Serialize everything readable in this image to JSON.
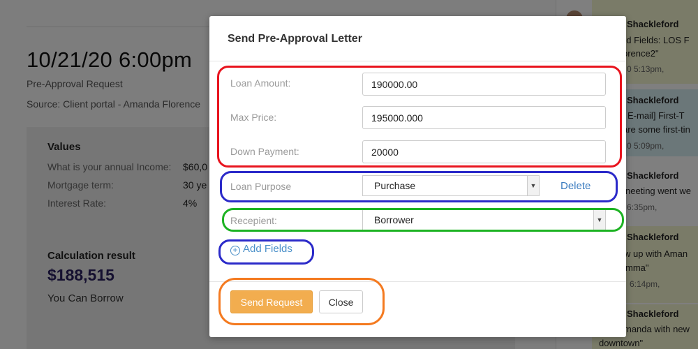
{
  "background": {
    "date": "10/21/20 6:00pm",
    "request_type": "Pre-Approval Request",
    "source": "Source: Client portal - Amanda Florence",
    "values_title": "Values",
    "values_rows": [
      {
        "label": "What is your annual Income:",
        "value": "$60,0"
      },
      {
        "label": "Mortgage term:",
        "value": "30 ye"
      },
      {
        "label": "Interest Rate:",
        "value": "4%"
      }
    ],
    "calc_title": "Calculation result",
    "calc_amount": "$188,515",
    "calc_sub": "You Can Borrow"
  },
  "messages": [
    {
      "name": "Shackleford",
      "lines": [
        "ed Fields: LOS F",
        "orence2\""
      ],
      "time": "0 5:13pm,"
    },
    {
      "name": "Shackleford",
      "lines": [
        "| E-mail] First-T",
        "are some first-tin"
      ],
      "time": "0 5:09pm,"
    },
    {
      "name": "Shackleford",
      "lines": [
        "neeting went we"
      ],
      "time": "6:35pm,"
    },
    {
      "name": "Shackleford",
      "lines": [
        "w up with Aman",
        "mma\""
      ],
      "time": "6:14pm,"
    },
    {
      "name": "Shackleford",
      "lines": [
        "manda with new",
        "downtown\""
      ],
      "time": ""
    }
  ],
  "modal": {
    "title": "Send Pre-Approval Letter",
    "fields": {
      "loan_amount_label": "Loan Amount:",
      "loan_amount_value": "190000.00",
      "max_price_label": "Max Price:",
      "max_price_value": "195000.000",
      "down_payment_label": "Down Payment:",
      "down_payment_value": "20000",
      "loan_purpose_label": "Loan Purpose",
      "loan_purpose_value": "Purchase",
      "delete_label": "Delete",
      "recipient_label": "Recepient:",
      "recipient_value": "Borrower",
      "add_fields_label": "Add Fields"
    },
    "buttons": {
      "send": "Send Request",
      "close": "Close"
    }
  },
  "colors": {
    "send_button": "#f2ad4f",
    "link": "#3a7bbf",
    "annotation_red": "#e8141e",
    "annotation_blue": "#2b2ac9",
    "annotation_green": "#1db323",
    "annotation_orange": "#f47a20"
  }
}
